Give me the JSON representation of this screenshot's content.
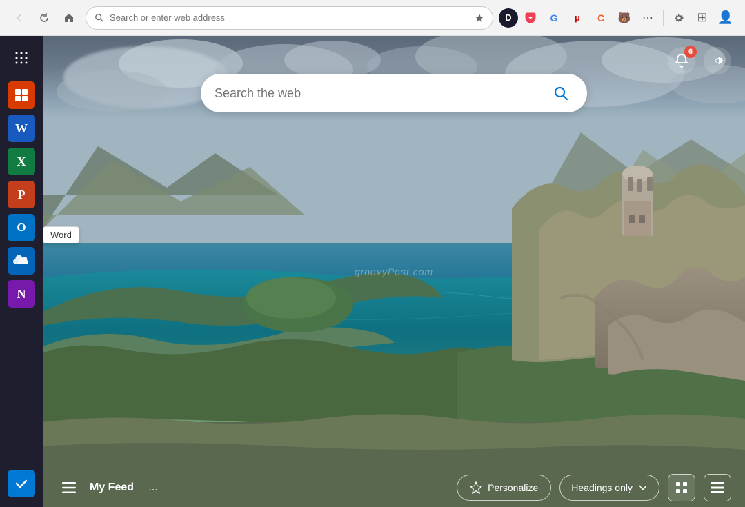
{
  "browser": {
    "address_placeholder": "Search or enter web address",
    "address_value": ""
  },
  "sidebar": {
    "apps": [
      {
        "id": "office",
        "label": "Microsoft 365",
        "icon": "⊞",
        "color": "#d83b01"
      },
      {
        "id": "word",
        "label": "Word",
        "icon": "W",
        "color": "#185abd"
      },
      {
        "id": "excel",
        "label": "Excel",
        "icon": "X",
        "color": "#107c41"
      },
      {
        "id": "powerpoint",
        "label": "PowerPoint",
        "icon": "P",
        "color": "#c43e1c"
      },
      {
        "id": "outlook",
        "label": "Outlook",
        "icon": "O",
        "color": "#0072c6"
      },
      {
        "id": "onedrive",
        "label": "OneDrive",
        "icon": "☁",
        "color": "#0364b8"
      },
      {
        "id": "onenote",
        "label": "OneNote",
        "icon": "N",
        "color": "#7719aa"
      }
    ],
    "bottom_apps": [
      {
        "id": "todo",
        "label": "Microsoft To Do",
        "icon": "✓",
        "color": "#0078d4"
      }
    ]
  },
  "tooltip": {
    "label": "Word"
  },
  "search": {
    "placeholder": "Search the web",
    "button_label": "Search"
  },
  "notifications": {
    "badge_count": "6"
  },
  "watermark": {
    "text": "groovyPost.com"
  },
  "bottom_bar": {
    "feed_label": "My Feed",
    "personalize_label": "Personalize",
    "headings_label": "Headings only",
    "dots": "..."
  }
}
